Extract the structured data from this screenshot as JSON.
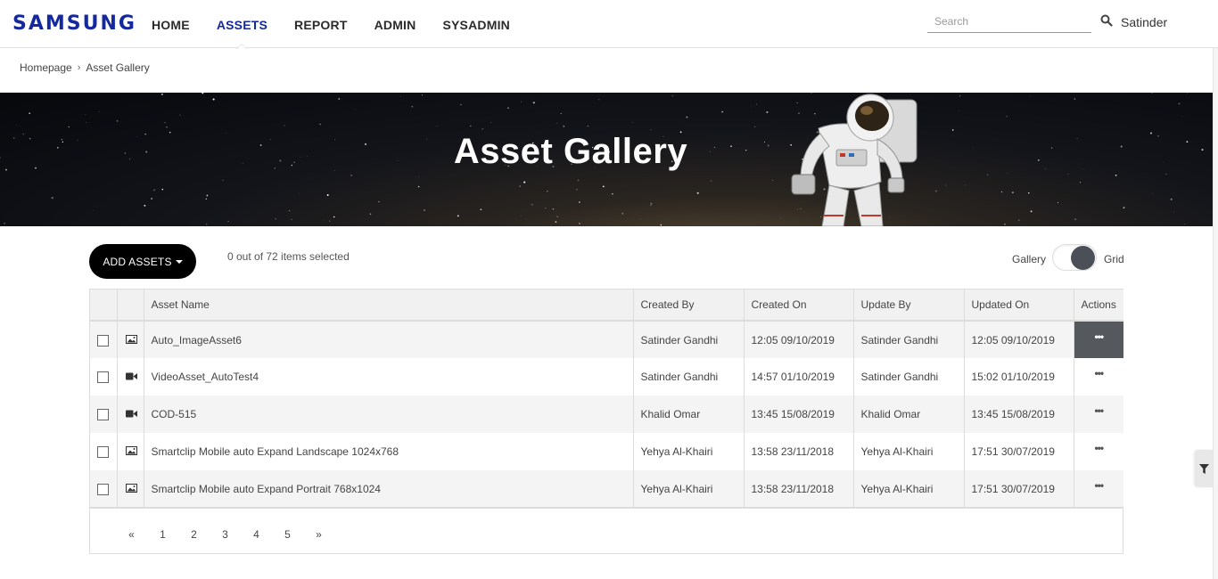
{
  "header": {
    "logo": "SAMSUNG",
    "nav": [
      {
        "label": "HOME",
        "active": false
      },
      {
        "label": "ASSETS",
        "active": true
      },
      {
        "label": "REPORT",
        "active": false
      },
      {
        "label": "ADMIN",
        "active": false
      },
      {
        "label": "SYSADMIN",
        "active": false
      }
    ],
    "search_placeholder": "Search",
    "search_value": "",
    "username": "Satinder"
  },
  "breadcrumb": {
    "home": "Homepage",
    "current": "Asset Gallery"
  },
  "banner": {
    "title": "Asset Gallery"
  },
  "toolbar": {
    "add_assets_label": "ADD ASSETS",
    "selection_text": "0 out of 72 items selected",
    "view_gallery_label": "Gallery",
    "view_grid_label": "Grid",
    "view_mode": "Grid"
  },
  "table": {
    "columns": [
      "",
      "",
      "Asset Name",
      "Created By",
      "Created On",
      "Update By",
      "Updated On",
      "Actions"
    ],
    "rows": [
      {
        "type_icon": "image-icon",
        "name": "Auto_ImageAsset6",
        "created_by": "Satinder Gandhi",
        "created_on": "12:05 09/10/2019",
        "updated_by": "Satinder Gandhi",
        "updated_on": "12:05 09/10/2019",
        "actions": "•••",
        "actions_active": true
      },
      {
        "type_icon": "video-icon",
        "name": "VideoAsset_AutoTest4",
        "created_by": "Satinder Gandhi",
        "created_on": "14:57 01/10/2019",
        "updated_by": "Satinder Gandhi",
        "updated_on": "15:02 01/10/2019",
        "actions": "•••",
        "actions_active": false
      },
      {
        "type_icon": "video-icon",
        "name": "COD-515",
        "created_by": "Khalid Omar",
        "created_on": "13:45 15/08/2019",
        "updated_by": "Khalid Omar",
        "updated_on": "13:45 15/08/2019",
        "actions": "•••",
        "actions_active": false
      },
      {
        "type_icon": "image-icon",
        "name": "Smartclip Mobile auto Expand Landscape 1024x768",
        "created_by": "Yehya Al-Khairi",
        "created_on": "13:58 23/11/2018",
        "updated_by": "Yehya Al-Khairi",
        "updated_on": "17:51 30/07/2019",
        "actions": "•••",
        "actions_active": false
      },
      {
        "type_icon": "image-icon",
        "name": "Smartclip Mobile auto Expand Portrait 768x1024",
        "created_by": "Yehya Al-Khairi",
        "created_on": "13:58 23/11/2018",
        "updated_by": "Yehya Al-Khairi",
        "updated_on": "17:51 30/07/2019",
        "actions": "•••",
        "actions_active": false
      }
    ]
  },
  "pagination": {
    "prev": "«",
    "pages": [
      "1",
      "2",
      "3",
      "4",
      "5"
    ],
    "next": "»"
  },
  "colors": {
    "brand": "#1428a0",
    "active_nav": "#1428a0",
    "button_bg": "#000000",
    "actions_active_bg": "#55585d",
    "toggle_knob": "#4b4f57"
  }
}
